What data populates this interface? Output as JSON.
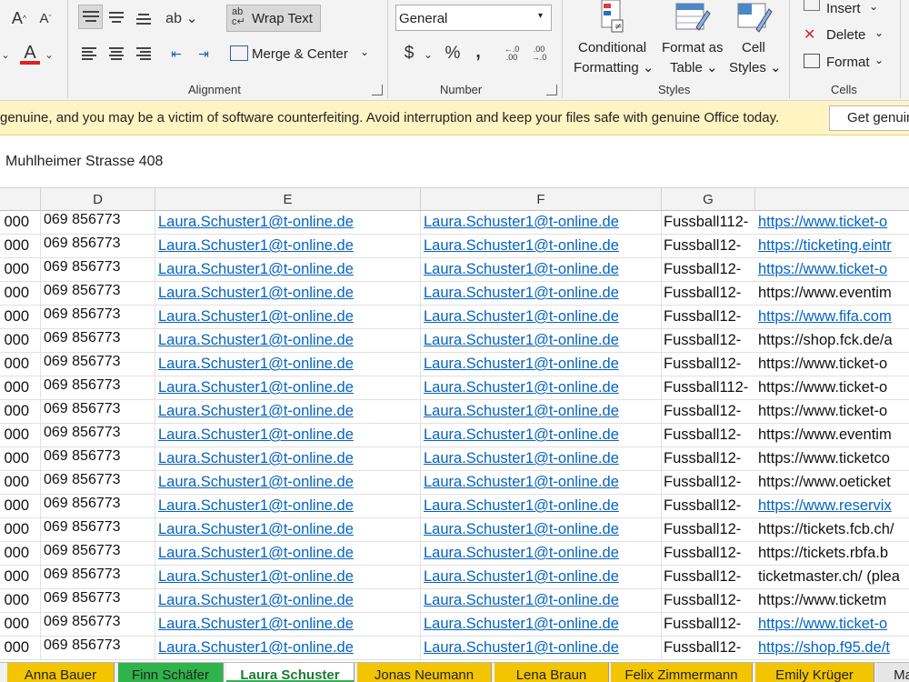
{
  "ribbon": {
    "wrap_text": "Wrap Text",
    "merge_center": "Merge & Center",
    "number_format": "General",
    "currency": "$",
    "percent": "%",
    "comma": ",",
    "conditional": [
      "Conditional",
      "Formatting ⌄"
    ],
    "format_table": [
      "Format as",
      "Table ⌄"
    ],
    "cell_styles": [
      "Cell",
      "Styles ⌄"
    ],
    "insert": "Insert",
    "delete": "Delete",
    "format": "Format",
    "groups": {
      "alignment": "Alignment",
      "number": "Number",
      "styles": "Styles",
      "cells": "Cells"
    }
  },
  "warning": {
    "text": "genuine, and you may be a victim of software counterfeiting. Avoid interruption and keep your files safe with genuine Office today.",
    "button": "Get genuine"
  },
  "formula_bar": {
    "value": "Muhlheimer Strasse 408"
  },
  "columns": [
    "D",
    "E",
    "F",
    "G"
  ],
  "rows": [
    {
      "c": "000",
      "d": "069 856773",
      "e": "Laura.Schuster1@t-online.de",
      "f": "Laura.Schuster1@t-online.de",
      "g": "Fussball112-",
      "h": "https://www.ticket-o",
      "h_link": true
    },
    {
      "c": "000",
      "d": "069 856773",
      "e": "Laura.Schuster1@t-online.de",
      "f": "Laura.Schuster1@t-online.de",
      "g": "Fussball12-",
      "h": "https://ticketing.eintr",
      "h_link": true
    },
    {
      "c": "000",
      "d": "069 856773",
      "e": "Laura.Schuster1@t-online.de",
      "f": "Laura.Schuster1@t-online.de",
      "g": "Fussball12-",
      "h": "https://www.ticket-o",
      "h_link": true
    },
    {
      "c": "000",
      "d": "069 856773",
      "e": "Laura.Schuster1@t-online.de",
      "f": "Laura.Schuster1@t-online.de",
      "g": "Fussball12-",
      "h": "https://www.eventim",
      "h_link": false
    },
    {
      "c": "000",
      "d": "069 856773",
      "e": "Laura.Schuster1@t-online.de",
      "f": "Laura.Schuster1@t-online.de",
      "g": "Fussball12-",
      "h": "https://www.fifa.com",
      "h_link": true
    },
    {
      "c": "000",
      "d": "069 856773",
      "e": "Laura.Schuster1@t-online.de",
      "f": "Laura.Schuster1@t-online.de",
      "g": "Fussball12-",
      "h": "https://shop.fck.de/a",
      "h_link": false
    },
    {
      "c": "000",
      "d": "069 856773",
      "e": "Laura.Schuster1@t-online.de",
      "f": "Laura.Schuster1@t-online.de",
      "g": "Fussball12-",
      "h": "https://www.ticket-o",
      "h_link": false
    },
    {
      "c": "000",
      "d": "069 856773",
      "e": "Laura.Schuster1@t-online.de",
      "f": "Laura.Schuster1@t-online.de",
      "g": "Fussball112-",
      "h": "https://www.ticket-o",
      "h_link": false
    },
    {
      "c": "000",
      "d": "069 856773",
      "e": "Laura.Schuster1@t-online.de",
      "f": "Laura.Schuster1@t-online.de",
      "g": "Fussball12-",
      "h": "https://www.ticket-o",
      "h_link": false
    },
    {
      "c": "000",
      "d": "069 856773",
      "e": "Laura.Schuster1@t-online.de",
      "f": "Laura.Schuster1@t-online.de",
      "g": "Fussball12-",
      "h": "https://www.eventim",
      "h_link": false
    },
    {
      "c": "000",
      "d": "069 856773",
      "e": "Laura.Schuster1@t-online.de",
      "f": "Laura.Schuster1@t-online.de",
      "g": "Fussball12-",
      "h": "https://www.ticketco",
      "h_link": false
    },
    {
      "c": "000",
      "d": "069 856773",
      "e": "Laura.Schuster1@t-online.de",
      "f": "Laura.Schuster1@t-online.de",
      "g": "Fussball12-",
      "h": "https://www.oeticket",
      "h_link": false
    },
    {
      "c": "000",
      "d": "069 856773",
      "e": "Laura.Schuster1@t-online.de",
      "f": "Laura.Schuster1@t-online.de",
      "g": "Fussball12-",
      "h": "https://www.reservix",
      "h_link": true
    },
    {
      "c": "000",
      "d": "069 856773",
      "e": "Laura.Schuster1@t-online.de",
      "f": "Laura.Schuster1@t-online.de",
      "g": "Fussball12-",
      "h": "https://tickets.fcb.ch/",
      "h_link": false
    },
    {
      "c": "000",
      "d": "069 856773",
      "e": "Laura.Schuster1@t-online.de",
      "f": "Laura.Schuster1@t-online.de",
      "g": "Fussball12-",
      "h": "https://tickets.rbfa.b",
      "h_link": false
    },
    {
      "c": "000",
      "d": "069 856773",
      "e": "Laura.Schuster1@t-online.de",
      "f": "Laura.Schuster1@t-online.de",
      "g": "Fussball12-",
      "h": "ticketmaster.ch/ (plea",
      "h_link": false
    },
    {
      "c": "000",
      "d": "069 856773",
      "e": "Laura.Schuster1@t-online.de",
      "f": "Laura.Schuster1@t-online.de",
      "g": "Fussball12-",
      "h": "https://www.ticketm",
      "h_link": false
    },
    {
      "c": "000",
      "d": "069 856773",
      "e": "Laura.Schuster1@t-online.de",
      "f": "Laura.Schuster1@t-online.de",
      "g": "Fussball12-",
      "h": "https://www.ticket-o",
      "h_link": true
    },
    {
      "c": "000",
      "d": "069 856773",
      "e": "Laura.Schuster1@t-online.de",
      "f": "Laura.Schuster1@t-online.de",
      "g": "Fussball12-",
      "h": "https://shop.f95.de/t",
      "h_link": true
    }
  ],
  "sheet_tabs": [
    {
      "label": "Anna Bauer",
      "color": "#f2c500",
      "active": false
    },
    {
      "label": "Finn Schäfer",
      "color": "#2fb34a",
      "active": false
    },
    {
      "label": "Laura Schuster",
      "color": "#2fb34a",
      "active": true
    },
    {
      "label": "Jonas Neumann",
      "color": "#f2c500",
      "active": false
    },
    {
      "label": "Lena Braun",
      "color": "#f2c500",
      "active": false
    },
    {
      "label": "Felix Zimmermann",
      "color": "#f2c500",
      "active": false
    },
    {
      "label": "Emily Krüger",
      "color": "#f2c500",
      "active": false
    },
    {
      "label": "Ma",
      "color": "#e6e6e6",
      "active": false
    }
  ]
}
